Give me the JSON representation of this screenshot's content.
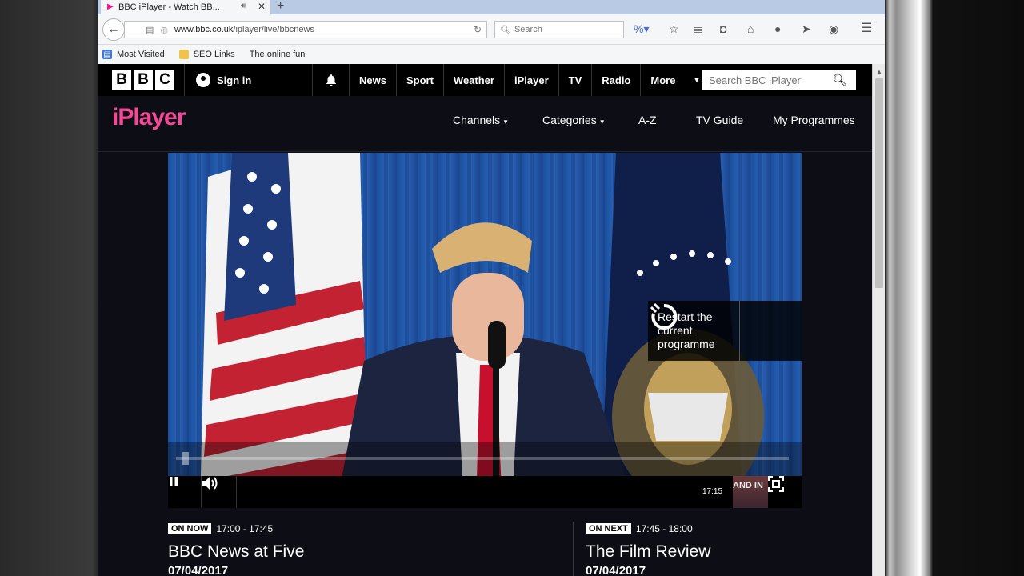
{
  "browser": {
    "tab_title": "BBC iPlayer - Watch BB...",
    "url_domain": "www.bbc.co.uk",
    "url_path": "/iplayer/live/bbcnews",
    "search_placeholder": "Search",
    "bookmarks": [
      "Most Visited",
      "SEO Links",
      "The online fun"
    ]
  },
  "bbc_bar": {
    "logo_letters": [
      "B",
      "B",
      "C"
    ],
    "signin_label": "Sign in",
    "nav_items": [
      "News",
      "Sport",
      "Weather",
      "iPlayer",
      "TV",
      "Radio",
      "More"
    ],
    "search_placeholder": "Search BBC iPlayer"
  },
  "iplayer_bar": {
    "logo": "iPlayer",
    "nav": {
      "channels": "Channels",
      "categories": "Categories",
      "az": "A-Z",
      "tv_guide": "TV Guide",
      "my_programmes": "My Programmes"
    }
  },
  "player": {
    "restart_text": "Restart the current programme",
    "time": "17:15",
    "thumbnail_text": "AND IN",
    "progress_fraction": 0.01
  },
  "schedule": {
    "now": {
      "badge": "ON NOW",
      "time": "17:00 - 17:45",
      "title": "BBC News at Five",
      "date": "07/04/2017"
    },
    "next": {
      "badge": "ON NEXT",
      "time": "17:45 - 18:00",
      "title": "The Film Review",
      "date": "07/04/2017"
    }
  },
  "colors": {
    "iplayer_pink": "#f54997",
    "page_bg": "#0d0d15",
    "bbc_bar_bg": "#000000"
  }
}
